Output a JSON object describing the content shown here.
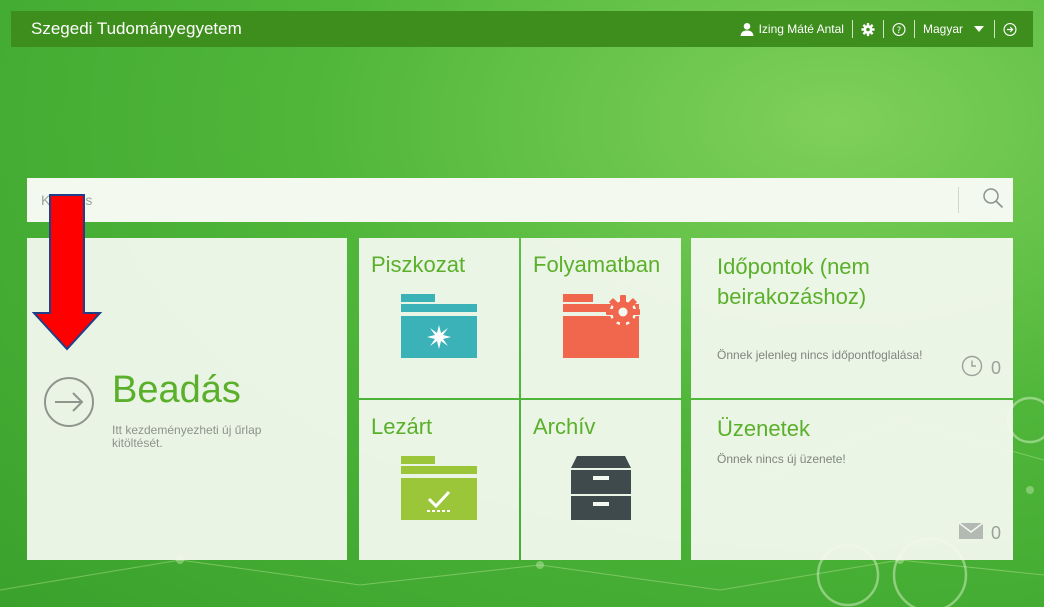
{
  "topbar": {
    "brand": "Szegedi Tudományegyetem",
    "user_name": "Izing Máté Antal",
    "language": "Magyar"
  },
  "search": {
    "placeholder": "Keresés"
  },
  "submit": {
    "title": "Beadás",
    "description": "Itt kezdeményezheti új űrlap kitöltését."
  },
  "tiles": {
    "draft": "Piszkozat",
    "in_progress": "Folyamatban",
    "closed": "Lezárt",
    "archive": "Archív"
  },
  "appointments": {
    "title": "Időpontok (nem beirakozáshoz)",
    "message": "Önnek jelenleg nincs időpontfoglalása!",
    "count": "0"
  },
  "messages": {
    "title": "Üzenetek",
    "message": "Önnek nincs új üzenete!",
    "count": "0"
  },
  "colors": {
    "accent_green": "#5bb02b",
    "topbar": "#3d8e1c",
    "teal": "#3ab2b8",
    "coral": "#f0674e",
    "lime": "#9cc63a",
    "dark_gray": "#3f4a4d",
    "annotation_red": "#ff0000"
  },
  "icons": {
    "user": "user-icon",
    "settings": "gear-icon",
    "help": "help-icon",
    "language_dropdown": "chevron-down-icon",
    "logout": "logout-icon",
    "search": "search-icon",
    "submit": "arrow-circle-right-icon",
    "draft": "folder-star-icon",
    "in_progress": "folder-gear-icon",
    "closed": "folder-check-icon",
    "archive": "archive-cabinet-icon",
    "clock": "clock-icon",
    "envelope": "envelope-icon",
    "annotation": "red-down-arrow"
  }
}
